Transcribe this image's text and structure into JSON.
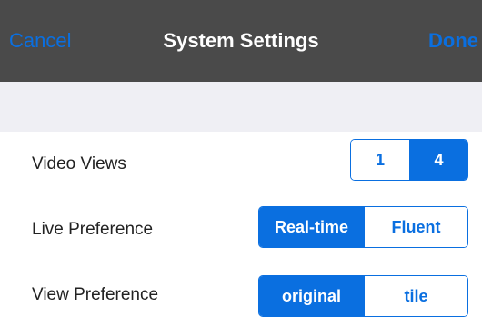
{
  "navbar": {
    "cancel_label": "Cancel",
    "title": "System Settings",
    "done_label": "Done"
  },
  "settings": {
    "video_views": {
      "label": "Video Views",
      "options": [
        "1",
        "4"
      ],
      "selected": "4"
    },
    "live_preference": {
      "label": "Live Preference",
      "options": [
        "Real-time",
        "Fluent"
      ],
      "selected": "Real-time"
    },
    "view_preference": {
      "label": "View Preference",
      "options": [
        "original",
        "tile"
      ],
      "selected": "original"
    }
  },
  "colors": {
    "accent": "#0a6fe0",
    "navbar_bg": "#4a4a4a",
    "group_bg": "#efeff4"
  }
}
